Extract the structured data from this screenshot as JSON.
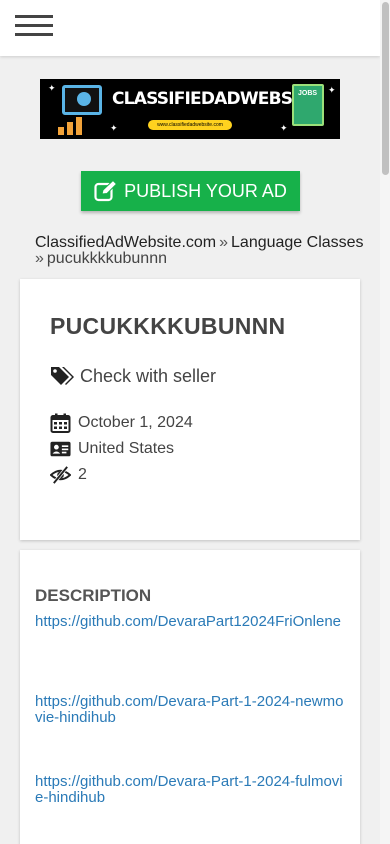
{
  "header": {
    "menu_icon": "hamburger-icon"
  },
  "logo": {
    "title": "CLASSIFIEDADWEBSITE",
    "url": "www.classifiedadwebsite.com",
    "badge": "JOBS"
  },
  "publish_button": {
    "label": "PUBLISH YOUR AD",
    "icon": "edit-icon",
    "color": "#17b14a"
  },
  "breadcrumb": {
    "items": [
      "ClassifiedAdWebsite.com",
      "Language Classes"
    ],
    "separator": "»",
    "current": "pucukkkkubunnn"
  },
  "ad": {
    "title": "PUCUKKKKUBUNNN",
    "price_text": "Check with seller",
    "date": "October 1, 2024",
    "location": "United States",
    "views": "2"
  },
  "description": {
    "heading": "DESCRIPTION",
    "links": [
      "https://github.com/DevaraPart12024FriOnlene",
      "https://github.com/Devara-Part-1-2024-newmovie-hindihub",
      "https://github.com/Devara-Part-1-2024-fulmovie-hindihub"
    ]
  },
  "colors": {
    "link": "#2a7ab7",
    "accent": "#17b14a",
    "text": "#444444"
  }
}
